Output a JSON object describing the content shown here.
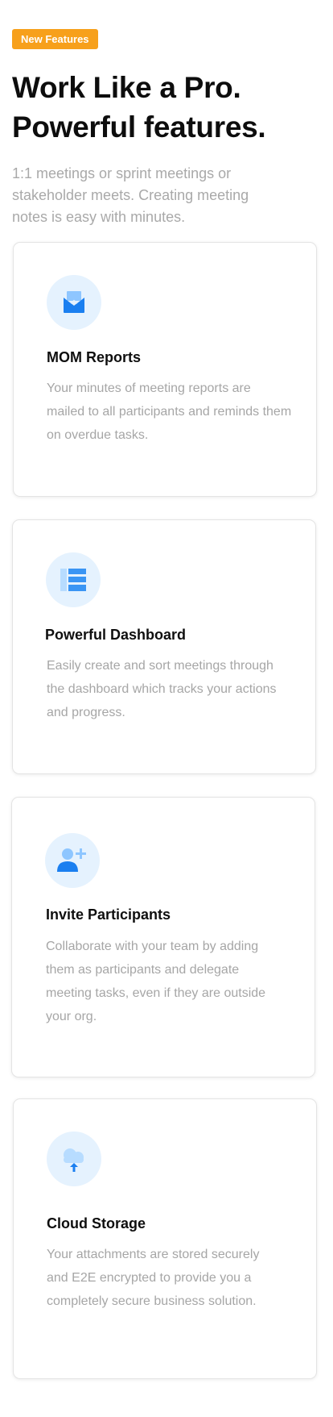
{
  "badge": "New Features",
  "heading": {
    "line1": "Work Like a Pro.",
    "line2": "Powerful features."
  },
  "subtitle": "1:1 meetings or sprint meetings or stakeholder meets. Creating meeting notes is easy with minutes.",
  "colors": {
    "accent": "#f7a01b",
    "icon_primary": "#1a7ff0",
    "icon_secondary": "#8ec6ff",
    "icon_bg": "#e5f2fe",
    "muted_text": "#a6a6a6"
  },
  "features": [
    {
      "icon": "mail-icon",
      "title": "MOM Reports",
      "description": "Your minutes of meeting reports are mailed to all participants and reminds them on overdue tasks."
    },
    {
      "icon": "dashboard-icon",
      "title": "Powerful Dashboard",
      "description": "Easily create and sort meetings through the dashboard which tracks your actions and progress."
    },
    {
      "icon": "add-user-icon",
      "title": "Invite Participants",
      "description": "Collaborate with your team by adding them as participants and delegate meeting tasks, even if they are outside your org."
    },
    {
      "icon": "cloud-upload-icon",
      "title": "Cloud Storage",
      "description": "Your attachments are stored securely and E2E encrypted to provide you a completely secure business solution."
    }
  ]
}
